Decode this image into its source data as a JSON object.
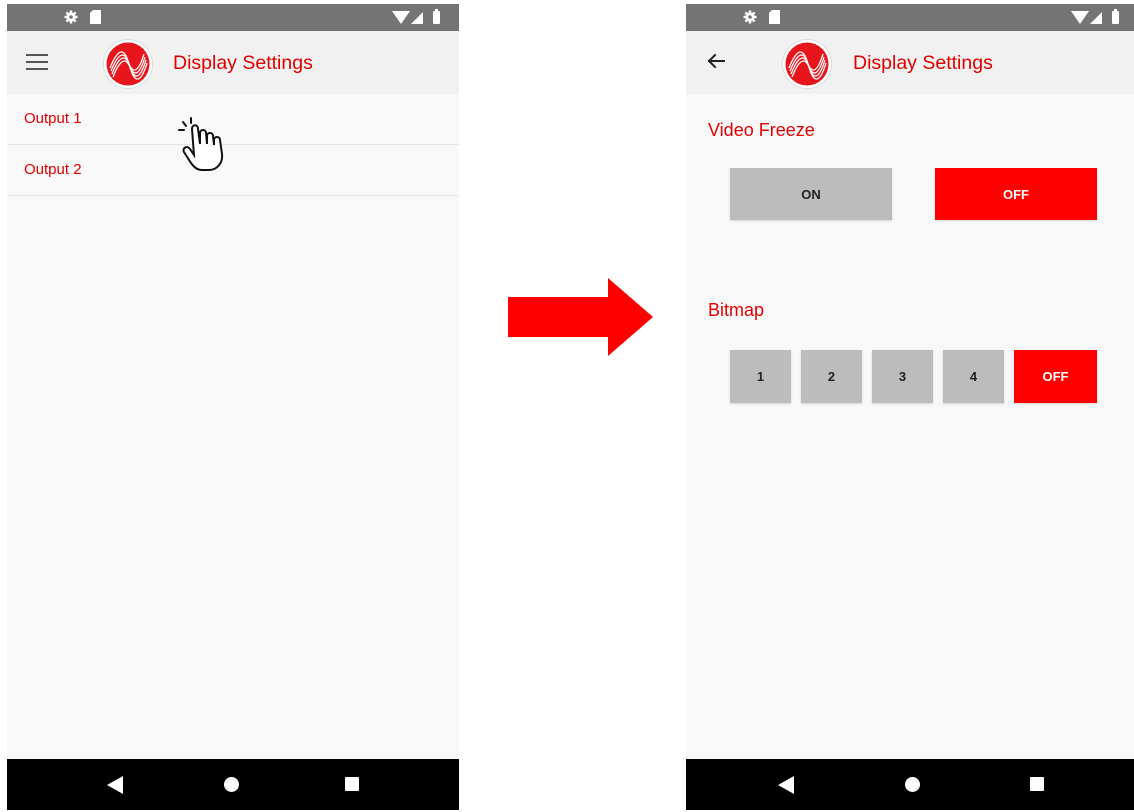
{
  "colors": {
    "accent": "#e30000",
    "button_active": "#ff0000",
    "button_inactive": "#bcbcbc"
  },
  "left_screen": {
    "status_icons": [
      "gear-icon",
      "sd-card-icon",
      "wifi-icon",
      "signal-icon",
      "battery-icon"
    ],
    "menu_icon": "hamburger-menu-icon",
    "title": "Display Settings",
    "list": [
      {
        "label": "Output 1"
      },
      {
        "label": "Output 2"
      }
    ]
  },
  "right_screen": {
    "status_icons": [
      "gear-icon",
      "sd-card-icon",
      "wifi-icon",
      "signal-icon",
      "battery-icon"
    ],
    "back_icon": "back-arrow-icon",
    "title": "Display Settings",
    "video_freeze": {
      "title": "Video Freeze",
      "on_label": "ON",
      "off_label": "OFF",
      "selected": "OFF"
    },
    "bitmap": {
      "title": "Bitmap",
      "options": [
        "1",
        "2",
        "3",
        "4",
        "OFF"
      ],
      "selected": "OFF"
    }
  },
  "nav_bar_icons": [
    "back-triangle-icon",
    "home-circle-icon",
    "recents-square-icon"
  ],
  "annotations": {
    "pointer": "hand-tap-icon",
    "transition": "right-arrow-icon"
  }
}
